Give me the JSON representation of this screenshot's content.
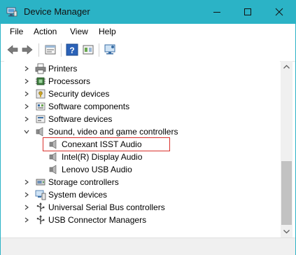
{
  "window": {
    "title": "Device Manager",
    "accent_color": "#2bb3c6"
  },
  "menu": {
    "items": [
      "File",
      "Action",
      "View",
      "Help"
    ]
  },
  "toolbar": {
    "buttons": [
      "back-arrow-icon",
      "forward-arrow-icon",
      "properties-icon",
      "help-icon",
      "update-driver-icon",
      "monitor-icon"
    ]
  },
  "tree": {
    "items": [
      {
        "label": "Printers",
        "icon": "printer-icon",
        "expanded": false
      },
      {
        "label": "Processors",
        "icon": "processor-icon",
        "expanded": false
      },
      {
        "label": "Security devices",
        "icon": "security-device-icon",
        "expanded": false
      },
      {
        "label": "Software components",
        "icon": "software-component-icon",
        "expanded": false
      },
      {
        "label": "Software devices",
        "icon": "software-device-icon",
        "expanded": false
      },
      {
        "label": "Sound, video and game controllers",
        "icon": "speaker-icon",
        "expanded": true
      },
      {
        "label": "Conexant ISST Audio",
        "icon": "speaker-icon",
        "child": true,
        "highlighted": true
      },
      {
        "label": "Intel(R) Display Audio",
        "icon": "speaker-icon",
        "child": true
      },
      {
        "label": "Lenovo USB Audio",
        "icon": "speaker-icon",
        "child": true
      },
      {
        "label": "Storage controllers",
        "icon": "storage-controller-icon",
        "expanded": false
      },
      {
        "label": "System devices",
        "icon": "system-device-icon",
        "expanded": false
      },
      {
        "label": "Universal Serial Bus controllers",
        "icon": "usb-icon",
        "expanded": false
      },
      {
        "label": "USB Connector Managers",
        "icon": "usb-icon",
        "expanded": false
      }
    ],
    "highlight_color": "#d9302c"
  }
}
